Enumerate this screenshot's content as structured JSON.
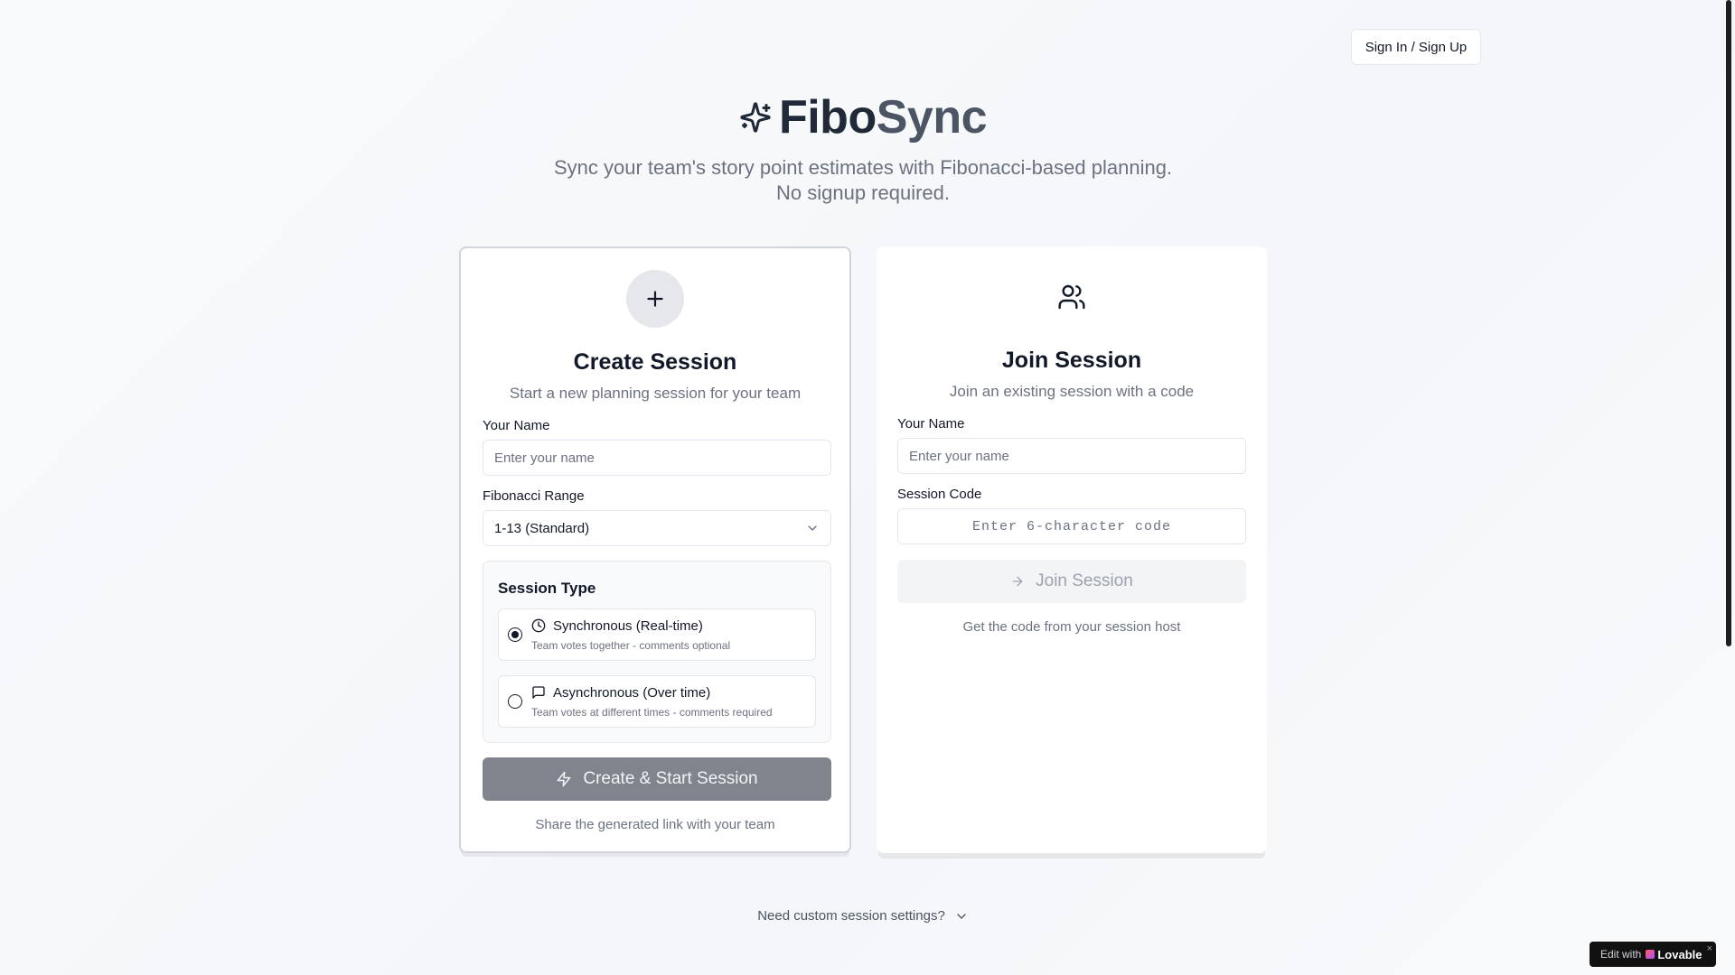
{
  "header": {
    "sign_in_label": "Sign In / Sign Up"
  },
  "hero": {
    "title_part1": "Fibo",
    "title_part2": "Sync",
    "subtitle_line1": "Sync your team's story point estimates with Fibonacci-based planning.",
    "subtitle_line2": "No signup required.",
    "icon": "sparkles-icon"
  },
  "create_card": {
    "icon": "plus-icon",
    "title": "Create Session",
    "subtitle": "Start a new planning session for your team",
    "name_label": "Your Name",
    "name_placeholder": "Enter your name",
    "name_value": "",
    "range_label": "Fibonacci Range",
    "range_selected": "1-13 (Standard)",
    "session_type": {
      "title": "Session Type",
      "options": [
        {
          "title": "Synchronous (Real-time)",
          "desc": "Team votes together - comments optional",
          "icon": "clock-icon",
          "checked": true
        },
        {
          "title": "Asynchronous (Over time)",
          "desc": "Team votes at different times - comments required",
          "icon": "message-square-icon",
          "checked": false
        }
      ]
    },
    "submit_label": "Create & Start Session",
    "footer_note": "Share the generated link with your team"
  },
  "join_card": {
    "icon": "users-icon",
    "title": "Join Session",
    "subtitle": "Join an existing session with a code",
    "name_label": "Your Name",
    "name_placeholder": "Enter your name",
    "name_value": "",
    "code_label": "Session Code",
    "code_placeholder": "Enter 6-character code",
    "submit_label": "Join Session",
    "footer_note": "Get the code from your session host"
  },
  "custom_settings_label": "Need custom session settings?",
  "badge": {
    "prefix": "Edit with",
    "brand": "Lovable",
    "close": "×"
  },
  "colors": {
    "primary_button": "#80848c",
    "text_dark": "#111827",
    "text_muted": "#6b7280"
  }
}
